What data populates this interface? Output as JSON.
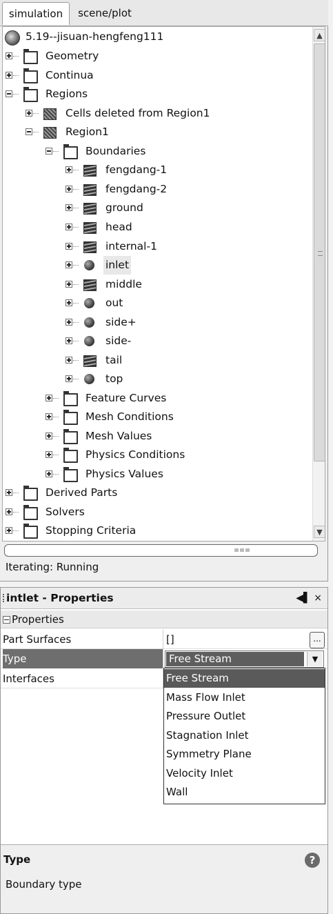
{
  "tabs": [
    "simulation",
    "scene/plot"
  ],
  "tree": {
    "root": "5.19--jisuan-hengfeng111",
    "nodes": {
      "geometry": "Geometry",
      "continua": "Continua",
      "regions": "Regions",
      "cells_deleted": "Cells deleted from Region1",
      "region1": "Region1",
      "boundaries": "Boundaries",
      "b_fengdang1": "fengdang-1",
      "b_fengdang2": "fengdang-2",
      "b_ground": "ground",
      "b_head": "head",
      "b_internal1": "internal-1",
      "b_inlet": "inlet",
      "b_middle": "middle",
      "b_out": "out",
      "b_sideplus": "side+",
      "b_sideminus": "side-",
      "b_tail": "tail",
      "b_top": "top",
      "feature_curves": "Feature Curves",
      "mesh_conditions": "Mesh Conditions",
      "mesh_values": "Mesh Values",
      "physics_conditions": "Physics Conditions",
      "physics_values": "Physics Values",
      "derived_parts": "Derived Parts",
      "solvers": "Solvers",
      "stopping_criteria": "Stopping Criteria"
    },
    "icons": {
      "folder": "folder-icon",
      "region": "region-icon",
      "boundary_wall": "boundary-surface-icon",
      "boundary_free_stream": "boundary-sphere-icon"
    }
  },
  "status": "Iterating: Running",
  "properties": {
    "title": "intlet - Properties",
    "title_buttons": "◀▌ ×",
    "section": "Properties",
    "rows": {
      "part_surfaces_key": "Part Surfaces",
      "part_surfaces_val": "[]",
      "ellipsis": "...",
      "type_key": "Type",
      "interfaces_key": "Interfaces"
    },
    "combo_value": "Free Stream",
    "options": [
      "Free Stream",
      "Mass Flow Inlet",
      "Pressure Outlet",
      "Stagnation Inlet",
      "Symmetry Plane",
      "Velocity Inlet",
      "Wall"
    ],
    "help_title": "Type",
    "help_desc": "Boundary type",
    "help_icon": "?"
  }
}
